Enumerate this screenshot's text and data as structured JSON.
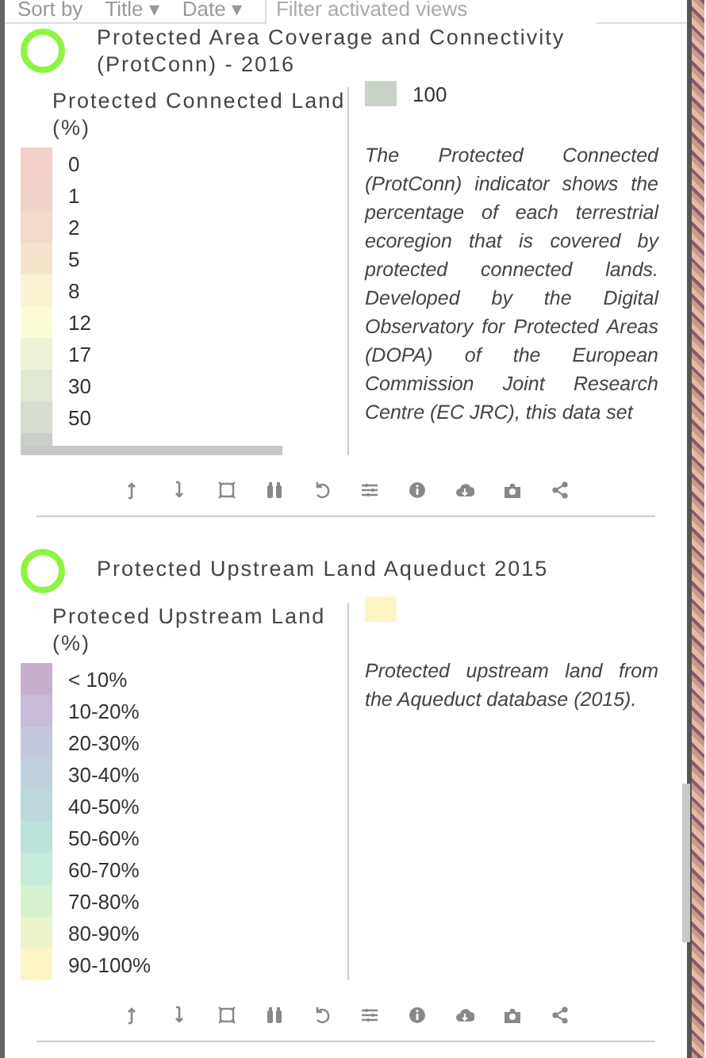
{
  "toolbar": {
    "sort_label": "Sort by",
    "sort_options": [
      {
        "label": "Title",
        "caret": "▾"
      },
      {
        "label": "Date",
        "caret": "▾"
      }
    ],
    "filter": {
      "placeholder": "Filter activated views"
    }
  },
  "views": [
    {
      "title": "Protected Area Coverage and Connectivity (ProtConn) - 2016",
      "legend": {
        "title": "Protected Connected Land (%)",
        "items": [
          {
            "label": "0",
            "color": "#f0d0c8"
          },
          {
            "label": "1",
            "color": "#efd2c9"
          },
          {
            "label": "2",
            "color": "#f2d9cc"
          },
          {
            "label": "5",
            "color": "#f5e4cc"
          },
          {
            "label": "8",
            "color": "#faf2d2"
          },
          {
            "label": "12",
            "color": "#fbfcd6"
          },
          {
            "label": "17",
            "color": "#eef2d8"
          },
          {
            "label": "30",
            "color": "#e0e8d4"
          },
          {
            "label": "50",
            "color": "#d4ddd0"
          },
          {
            "color": "#c8d0c8"
          }
        ],
        "scrollbar": true,
        "side_item": {
          "label": "100",
          "color": "#c8d2c6"
        }
      },
      "description": "The Protected Connected (ProtConn) indicator shows the percentage of each terrestrial ecoregion that is covered by protected connected lands. Developed by the Digital Observatory for Protected Areas (DOPA) of the European Commission Joint Research Centre (EC JRC), this data set"
    },
    {
      "title": "Protected Upstream Land Aqueduct 2015",
      "legend": {
        "title": "Proteced Upstream Land (%)",
        "items": [
          {
            "label": "< 10%",
            "color": "#c6b0cc"
          },
          {
            "label": "10-20%",
            "color": "#c8bcd8"
          },
          {
            "label": "20-30%",
            "color": "#c4c8dc"
          },
          {
            "label": "30-40%",
            "color": "#c0d0dc"
          },
          {
            "label": "40-50%",
            "color": "#bcd8dc"
          },
          {
            "label": "50-60%",
            "color": "#bce2dc"
          },
          {
            "label": "60-70%",
            "color": "#c4ecd8"
          },
          {
            "label": "70-80%",
            "color": "#d6f0d0"
          },
          {
            "label": "80-90%",
            "color": "#ecf4cc"
          },
          {
            "label": "90-100%",
            "color": "#fdf6c4"
          }
        ],
        "side_item": {
          "color": "#fdf6c4"
        }
      },
      "description": "Protected upstream land from the Aqueduct database (2015)."
    }
  ]
}
